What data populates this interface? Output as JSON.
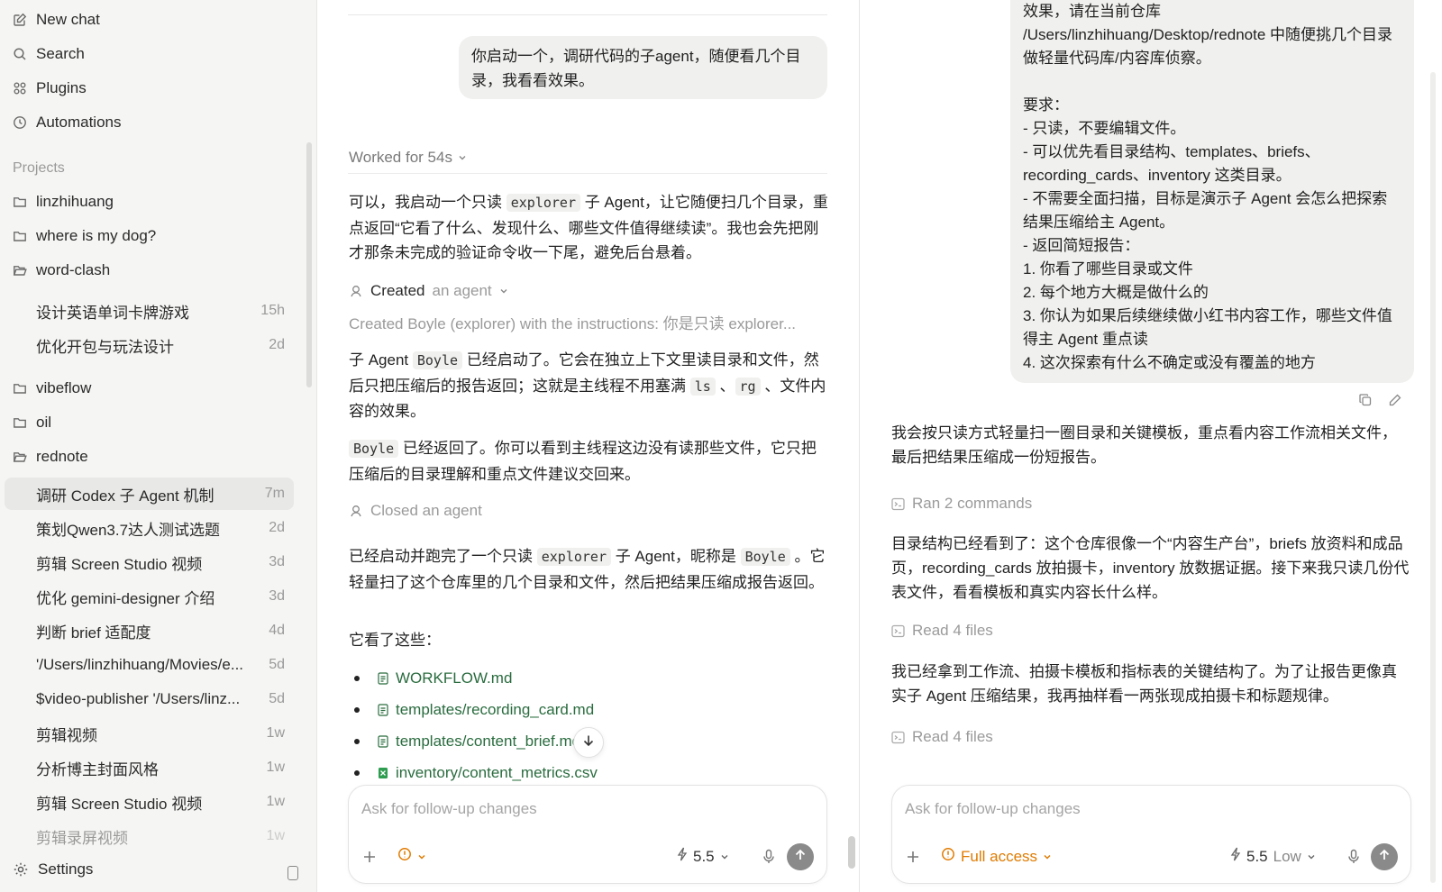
{
  "sidebar": {
    "nav": [
      {
        "label": "New chat",
        "icon": "new-chat-icon"
      },
      {
        "label": "Search",
        "icon": "search-icon"
      },
      {
        "label": "Plugins",
        "icon": "plugins-icon"
      },
      {
        "label": "Automations",
        "icon": "clock-icon"
      }
    ],
    "projects_label": "Projects",
    "projects": {
      "linzhihuang": "linzhihuang",
      "where_is_my_dog": "where is my dog?",
      "word_clash": "word-clash",
      "vibeflow": "vibeflow",
      "oil": "oil",
      "rednote": "rednote"
    },
    "word_clash_threads": [
      {
        "title": "设计英语单词卡牌游戏",
        "time": "15h"
      },
      {
        "title": "优化开包与玩法设计",
        "time": "2d"
      }
    ],
    "rednote_threads": [
      {
        "title": "调研 Codex 子 Agent 机制",
        "time": "7m"
      },
      {
        "title": "策划Qwen3.7达人测试选题",
        "time": "2d"
      },
      {
        "title": "剪辑 Screen Studio 视频",
        "time": "3d"
      },
      {
        "title": "优化 gemini-designer 介绍",
        "time": "3d"
      },
      {
        "title": "判断 brief 适配度",
        "time": "4d"
      },
      {
        "title": "'/Users/linzhihuang/Movies/e...",
        "time": "5d"
      },
      {
        "title": "$video-publisher '/Users/linz...",
        "time": "5d"
      },
      {
        "title": "剪辑视频",
        "time": "1w"
      },
      {
        "title": "分析博主封面风格",
        "time": "1w"
      },
      {
        "title": "剪辑 Screen Studio 视频",
        "time": "1w"
      },
      {
        "title": "剪辑录屏视频",
        "time": "1w"
      }
    ],
    "settings_label": "Settings"
  },
  "mid": {
    "user_message": "你启动一个，调研代码的子agent，随便看几个目录，我看看效果。",
    "worked_label": "Worked for 54s",
    "p1_a": "可以，我启动一个只读 ",
    "p1_code": "explorer",
    "p1_b": " 子 Agent，让它随便扫几个目录，重点返回“它看了什么、发现什么、哪些文件值得继续读”。我也会先把刚才那条未完成的验证命令收一下尾，避免后台悬着。",
    "created_label": "Created",
    "created_sub": "an agent",
    "created_desc": "Created Boyle (explorer) with the instructions: 你是只读 explorer...",
    "p2_a": "子 Agent ",
    "p2_code1": "Boyle",
    "p2_b": " 已经启动了。它会在独立上下文里读目录和文件，然后只把压缩后的报告返回；这就是主线程不用塞满 ",
    "p2_code2": "ls",
    "p2_c": " 、",
    "p2_code3": "rg",
    "p2_d": " 、文件内容的效果。",
    "p3_code": "Boyle",
    "p3_b": " 已经返回了。你可以看到主线程这边没有读那些文件，它只把压缩后的目录理解和重点文件建议交回来。",
    "closed_label": "Closed an agent",
    "p4_a": "已经启动并跑完了一个只读 ",
    "p4_code1": "explorer",
    "p4_b": " 子 Agent，昵称是 ",
    "p4_code2": "Boyle",
    "p4_c": " 。它轻量扫了这个仓库里的几个目录和文件，然后把结果压缩成报告返回。",
    "seen_label": "它看了这些：",
    "files": [
      {
        "name": "WORKFLOW.md",
        "icon": "document-icon"
      },
      {
        "name": "templates/recording_card.md",
        "icon": "document-icon"
      },
      {
        "name": "templates/content_brief.md",
        "icon": "document-icon"
      },
      {
        "name": "inventory/content_metrics.csv",
        "icon": "spreadsheet-icon"
      }
    ],
    "composer": {
      "placeholder": "Ask for follow-up changes",
      "model": "5.5"
    }
  },
  "right": {
    "bubble_text": "效果，请在当前仓库 /Users/linzhihuang/Desktop/rednote 中随便挑几个目录做轻量代码库/内容库侦察。\n\n要求：\n- 只读，不要编辑文件。\n- 可以优先看目录结构、templates、briefs、recording_cards、inventory 这类目录。\n- 不需要全面扫描，目标是演示子 Agent 会怎么把探索结果压缩给主 Agent。\n- 返回简短报告：\n  1. 你看了哪些目录或文件\n  2. 每个地方大概是做什么的\n  3. 你认为如果后续继续做小红书内容工作，哪些文件值得主 Agent 重点读\n  4. 这次探索有什么不确定或没有覆盖的地方",
    "r1": "我会按只读方式轻量扫一圈目录和关键模板，重点看内容工作流相关文件，最后把结果压缩成一份短报告。",
    "ran_label": "Ran 2 commands",
    "r2": "目录结构已经看到了：这个仓库很像一个“内容生产台”，briefs 放资料和成品页，recording_cards 放拍摄卡，inventory 放数据证据。接下来我只读几份代表文件，看看模板和真实内容长什么样。",
    "read1_label": "Read 4 files",
    "r3": "我已经拿到工作流、拍摄卡模板和指标表的关键结构了。为了让报告更像真实子 Agent 压缩结果，我再抽样看一两张现成拍摄卡和标题规律。",
    "read2_label": "Read 4 files",
    "composer": {
      "placeholder": "Ask for follow-up changes",
      "access": "Full access",
      "model": "5.5",
      "level": "Low"
    }
  },
  "colors": {
    "accent_orange": "#e07b00",
    "file_link_green": "#2a6c3f",
    "sidebar_bg": "#f5f5f3",
    "active_thread_bg": "#e8e8e6"
  }
}
